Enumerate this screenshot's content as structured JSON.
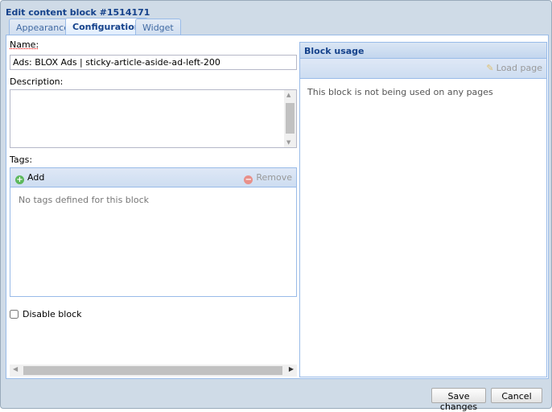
{
  "window": {
    "title": "Edit content block #1514171"
  },
  "tabs": [
    {
      "label": "Appearance"
    },
    {
      "label": "Configuration",
      "active": true
    },
    {
      "label": "Widget"
    }
  ],
  "form": {
    "name_label": "Name:",
    "name_value": "Ads: BLOX Ads | sticky-article-aside-ad-left-200",
    "description_label": "Description:",
    "description_value": "",
    "tags_label": "Tags:",
    "add_label": "Add",
    "remove_label": "Remove",
    "tags_empty": "No tags defined for this block",
    "disable_label": "Disable block",
    "disable_checked": false
  },
  "usage": {
    "title": "Block usage",
    "load_label": "Load page",
    "empty": "This block is not being used on any pages"
  },
  "footer": {
    "save_label": "Save changes",
    "cancel_label": "Cancel"
  },
  "colors": {
    "accent": "#15428b",
    "border": "#99bbe8",
    "window_bg": "#cfdbe7"
  }
}
